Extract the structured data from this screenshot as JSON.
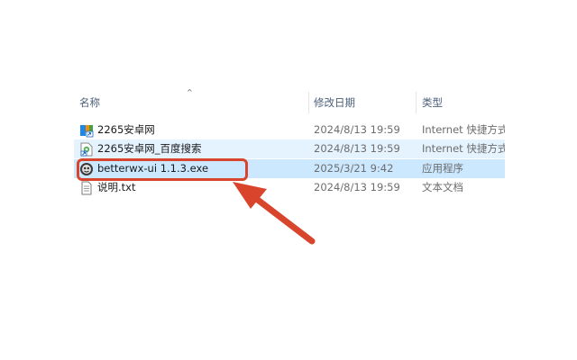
{
  "columns": {
    "name": "名称",
    "date": "修改日期",
    "type": "类型",
    "sort_indicator": "^"
  },
  "files": [
    {
      "name": "2265安卓网",
      "date": "2024/8/13 19:59",
      "type": "Internet 快捷方式",
      "icon": "internet-shortcut-icon",
      "state": "normal"
    },
    {
      "name": "2265安卓网_百度搜索",
      "date": "2024/8/13 19:59",
      "type": "Internet 快捷方式",
      "icon": "internet-shortcut-icon",
      "state": "hovered"
    },
    {
      "name": "betterwx-ui 1.1.3.exe",
      "date": "2025/3/21 9:42",
      "type": "应用程序",
      "icon": "application-icon",
      "state": "selected"
    },
    {
      "name": "说明.txt",
      "date": "2024/8/13 19:59",
      "type": "文本文档",
      "icon": "text-document-icon",
      "state": "normal"
    }
  ],
  "colors": {
    "selection": "#cce8ff",
    "hover": "#e5f3ff",
    "annotation": "#d9452c",
    "header_text": "#4c607a"
  }
}
